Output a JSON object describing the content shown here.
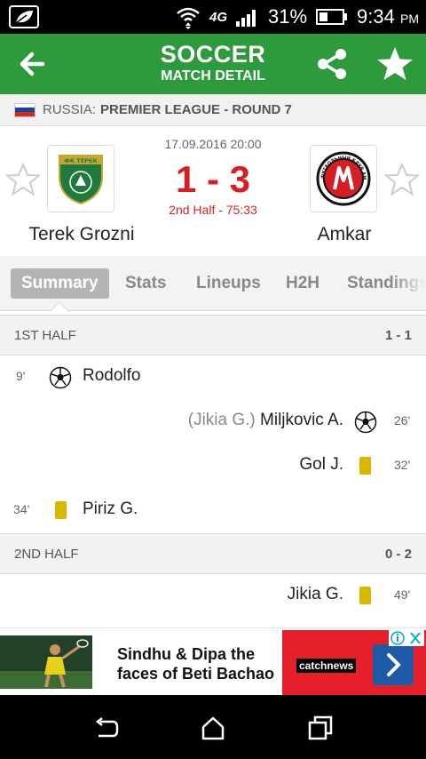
{
  "status_bar": {
    "network": "4G",
    "battery": "31%",
    "time": "9:34",
    "ampm": "PM"
  },
  "header": {
    "title": "SOCCER",
    "subtitle": "MATCH DETAIL",
    "icons": [
      "back-arrow-icon",
      "share-icon",
      "star-icon"
    ]
  },
  "league": {
    "country": "RUSSIA:",
    "competition": "PREMIER LEAGUE - ROUND 7",
    "flag_colors": [
      "#ffffff",
      "#1c3fa8",
      "#d52b1e"
    ]
  },
  "match": {
    "date": "17.09.2016 20:00",
    "score": "1 - 3",
    "status": "2nd Half - 75:33",
    "home": {
      "name": "Terek Grozni",
      "logo_text": "ФК ТЕРЕК"
    },
    "away": {
      "name": "Amkar",
      "logo_text": "ФУТБОЛЬНЫЙ КЛУБ АМКАР ПЕРМЬ"
    }
  },
  "tabs": [
    {
      "label": "Summary",
      "active": true
    },
    {
      "label": "Stats",
      "active": false
    },
    {
      "label": "Lineups",
      "active": false
    },
    {
      "label": "H2H",
      "active": false
    },
    {
      "label": "Standings",
      "active": false
    }
  ],
  "sections": [
    {
      "label": "1ST HALF",
      "score": "1 - 1",
      "events": [
        {
          "side": "home",
          "minute": "9'",
          "type": "goal",
          "player": "Rodolfo",
          "assist": ""
        },
        {
          "side": "away",
          "minute": "26'",
          "type": "goal",
          "player": "Miljkovic A.",
          "assist": "(Jikia G.)"
        },
        {
          "side": "away",
          "minute": "32'",
          "type": "yellow-card",
          "player": "Gol J.",
          "assist": ""
        },
        {
          "side": "home",
          "minute": "34'",
          "type": "yellow-card",
          "player": "Piriz G.",
          "assist": ""
        }
      ]
    },
    {
      "label": "2ND HALF",
      "score": "0 - 2",
      "events": [
        {
          "side": "away",
          "minute": "49'",
          "type": "yellow-card",
          "player": "Jikia G.",
          "assist": ""
        }
      ]
    }
  ],
  "ad": {
    "headline_1": "Sindhu & Dipa the",
    "headline_2": "faces of Beti Bachao",
    "brand": "catchnews"
  },
  "colors": {
    "header_green": "#2e9a3e",
    "score_red": "#d32027",
    "card_yellow": "#d7b800"
  }
}
